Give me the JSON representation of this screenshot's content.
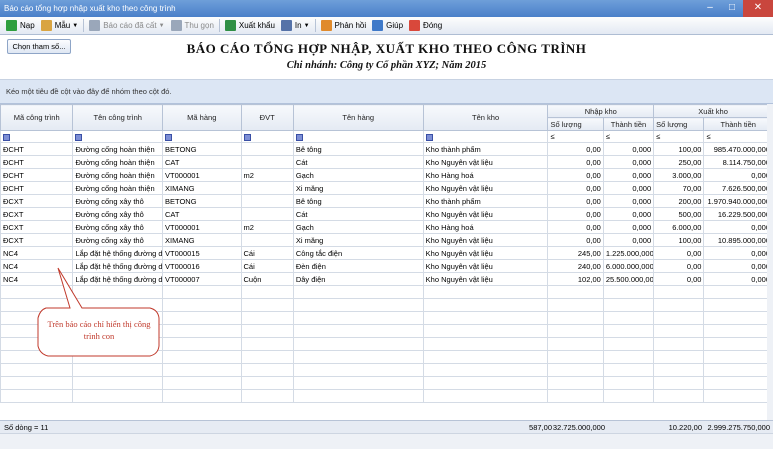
{
  "window": {
    "title": "Báo cáo tổng hợp nhập xuất kho theo công trình"
  },
  "toolbar": {
    "items": [
      {
        "label": "Nạp",
        "icon": "refresh-icon",
        "color": "#2e9e3e",
        "disabled": false,
        "caret": false
      },
      {
        "label": "Mẫu",
        "icon": "template-icon",
        "color": "#d9a441",
        "disabled": false,
        "caret": true
      },
      {
        "label": "Báo cáo đã cất",
        "icon": "saved-report-icon",
        "color": "#9aa7ba",
        "disabled": true,
        "caret": true
      },
      {
        "label": "Thu gọn",
        "icon": "collapse-icon",
        "color": "#9aa7ba",
        "disabled": true,
        "caret": false
      },
      {
        "label": "Xuất khẩu",
        "icon": "excel-icon",
        "color": "#2f8f45",
        "disabled": false,
        "caret": false
      },
      {
        "label": "In",
        "icon": "print-icon",
        "color": "#5572a8",
        "disabled": false,
        "caret": true
      },
      {
        "label": "Phản hồi",
        "icon": "feedback-icon",
        "color": "#e08a2c",
        "disabled": false,
        "caret": false
      },
      {
        "label": "Giúp",
        "icon": "help-icon",
        "color": "#3f79c9",
        "disabled": false,
        "caret": false
      },
      {
        "label": "Đóng",
        "icon": "close-icon",
        "color": "#d9483b",
        "disabled": false,
        "caret": false
      }
    ]
  },
  "header": {
    "select_button": "Chọn tham số...",
    "title": "BÁO CÁO TỔNG HỢP NHẬP, XUẤT KHO THEO CÔNG TRÌNH",
    "subtitle": "Chi nhánh: Công ty Cổ phần XYZ; Năm 2015"
  },
  "group_panel": {
    "hint": "Kéo một tiêu đề cột vào đây để nhóm theo cột đó."
  },
  "table": {
    "columns": {
      "ma_cong_trinh": "Mã công trình",
      "ten_cong_trinh": "Tên công trình",
      "ma_hang": "Mã hàng",
      "dvt": "ĐVT",
      "ten_hang": "Tên hàng",
      "ten_kho": "Tên kho",
      "nhap_kho": "Nhập kho",
      "xuat_kho": "Xuất kho",
      "so_luong": "Số lượng",
      "thanh_tien": "Thành tiền"
    },
    "filter_symbol": "≤",
    "rows": [
      [
        "ĐCHT",
        "Đường cống hoàn thiện",
        "BETONG",
        "",
        "Bê tông",
        "Kho thành phẩm",
        "0,00",
        "0,000",
        "100,00",
        "985.470.000,000"
      ],
      [
        "ĐCHT",
        "Đường cống hoàn thiện",
        "CAT",
        "",
        "Cát",
        "Kho Nguyên vật liệu",
        "0,00",
        "0,000",
        "250,00",
        "8.114.750,000"
      ],
      [
        "ĐCHT",
        "Đường cống hoàn thiện",
        "VT000001",
        "m2",
        "Gạch",
        "Kho Hàng hoá",
        "0,00",
        "0,000",
        "3.000,00",
        "0,000"
      ],
      [
        "ĐCHT",
        "Đường cống hoàn thiện",
        "XIMANG",
        "",
        "Xi măng",
        "Kho Nguyên vật liệu",
        "0,00",
        "0,000",
        "70,00",
        "7.626.500,000"
      ],
      [
        "ĐCXT",
        "Đường cống xây thô",
        "BETONG",
        "",
        "Bê tông",
        "Kho thành phẩm",
        "0,00",
        "0,000",
        "200,00",
        "1.970.940.000,000"
      ],
      [
        "ĐCXT",
        "Đường cống xây thô",
        "CAT",
        "",
        "Cát",
        "Kho Nguyên vật liệu",
        "0,00",
        "0,000",
        "500,00",
        "16.229.500,000"
      ],
      [
        "ĐCXT",
        "Đường cống xây thô",
        "VT000001",
        "m2",
        "Gạch",
        "Kho Hàng hoá",
        "0,00",
        "0,000",
        "6.000,00",
        "0,000"
      ],
      [
        "ĐCXT",
        "Đường cống xây thô",
        "XIMANG",
        "",
        "Xi măng",
        "Kho Nguyên vật liệu",
        "0,00",
        "0,000",
        "100,00",
        "10.895.000,000"
      ],
      [
        "NC4",
        "Lắp đặt hệ thống đường d",
        "VT000015",
        "Cái",
        "Công tắc điện",
        "Kho Nguyên vật liệu",
        "245,00",
        "1.225.000,000",
        "0,00",
        "0,000"
      ],
      [
        "NC4",
        "Lắp đặt hệ thống đường d",
        "VT000016",
        "Cái",
        "Đèn điện",
        "Kho Nguyên vật liệu",
        "240,00",
        "6.000.000,000",
        "0,00",
        "0,000"
      ],
      [
        "NC4",
        "Lắp đặt hệ thống đường d",
        "VT000007",
        "Cuộn",
        "Dây điện",
        "Kho Nguyên vật liệu",
        "102,00",
        "25.500.000,000",
        "0,00",
        "0,000"
      ]
    ]
  },
  "footer": {
    "row_count": "Số dòng = 11",
    "nhap_so_luong": "587,00",
    "nhap_thanh_tien": "32.725.000,000",
    "xuat_so_luong": "10.220,00",
    "xuat_thanh_tien": "2.999.275.750,000"
  },
  "callout": {
    "text": "Trên báo cáo chỉ hiển thị công trình con",
    "color": "#c0392b"
  }
}
